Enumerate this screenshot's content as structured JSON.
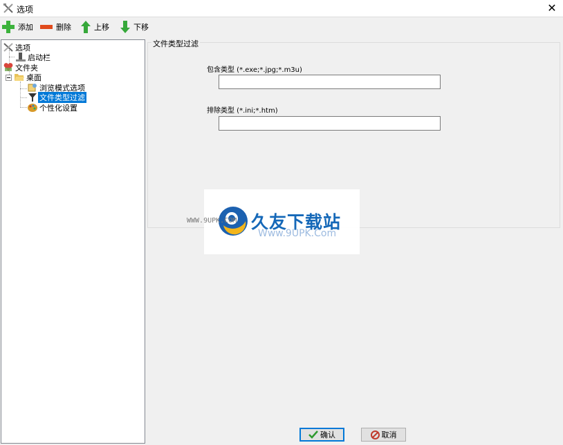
{
  "window": {
    "title": "选项"
  },
  "toolbar": {
    "add": "添加",
    "delete": "删除",
    "move_up": "上移",
    "move_down": "下移"
  },
  "tree": {
    "root": "选项",
    "startup_bar": "启动栏",
    "folder": "文件夹",
    "desktop": "桌面",
    "browse_mode": "浏览模式选项",
    "file_type_filter": "文件类型过滤",
    "personalize": "个性化设置",
    "selected": "文件类型过滤"
  },
  "panel": {
    "group_title": "文件类型过滤",
    "include_label": "包含类型 (*.exe;*.jpg;*.m3u)",
    "include_value": "",
    "exclude_label": "排除类型 (*.ini;*.htm)",
    "exclude_value": ""
  },
  "watermark": {
    "site_cn": "久友下载站",
    "url_left": "WWW.9UPK.COM",
    "url_right": "Www.9UPK.Com"
  },
  "buttons": {
    "ok": "确认",
    "cancel": "取消"
  },
  "colors": {
    "selection": "#0078d7",
    "add_green": "#3cb23c",
    "delete_red": "#e04a1c",
    "arrow_green": "#36a83a"
  }
}
